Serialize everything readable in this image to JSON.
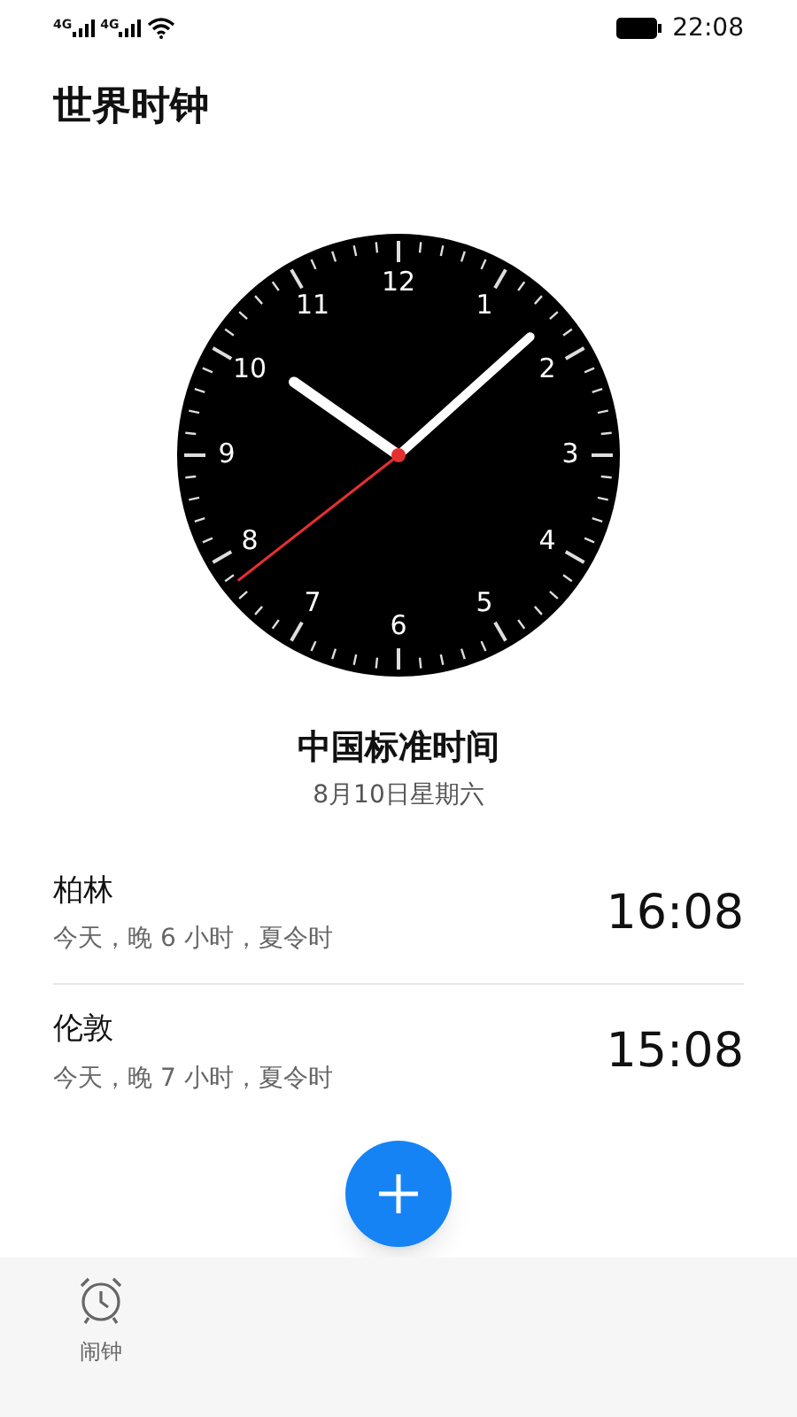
{
  "status_bar": {
    "network_labels": [
      "4G",
      "4G"
    ],
    "time": "22:08"
  },
  "title": "世界时钟",
  "clock": {
    "numbers": [
      "12",
      "1",
      "2",
      "3",
      "4",
      "5",
      "6",
      "7",
      "8",
      "9",
      "10",
      "11"
    ]
  },
  "home": {
    "name": "中国标准时间",
    "date": "8月10日星期六"
  },
  "cities": [
    {
      "name": "柏林",
      "offset": "今天，晚 6 小时，夏令时",
      "time": "16:08"
    },
    {
      "name": "伦敦",
      "offset": "今天，晚 7 小时，夏令时",
      "time": "15:08"
    }
  ],
  "nav": [
    {
      "label": "闹钟",
      "selected": false
    }
  ]
}
